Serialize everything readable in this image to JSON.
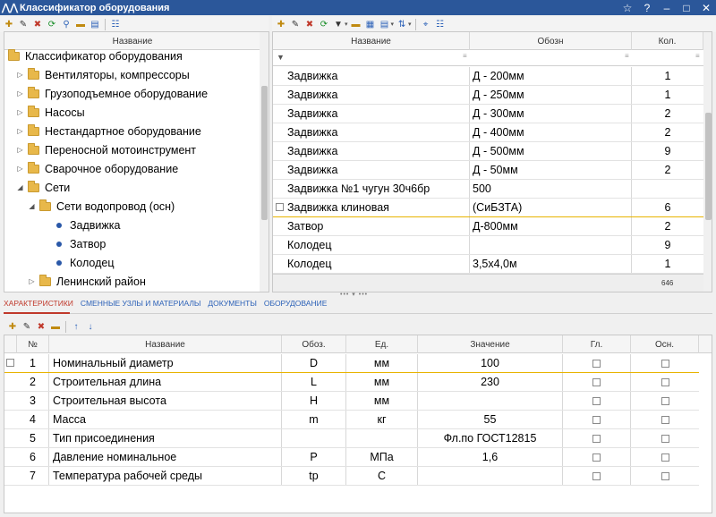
{
  "window": {
    "title": "Классификатор оборудования"
  },
  "tree": {
    "header": "Название",
    "items": [
      {
        "label": "Классификатор оборудования",
        "level": 0,
        "kind": "folder",
        "toggle": ""
      },
      {
        "label": "Вентиляторы, компрессоры",
        "level": 1,
        "kind": "folder",
        "toggle": "▷"
      },
      {
        "label": "Грузоподъемное оборудование",
        "level": 1,
        "kind": "folder",
        "toggle": "▷"
      },
      {
        "label": "Насосы",
        "level": 1,
        "kind": "folder",
        "toggle": "▷"
      },
      {
        "label": "Нестандартное оборудование",
        "level": 1,
        "kind": "folder",
        "toggle": "▷"
      },
      {
        "label": "Переносной мотоинструмент",
        "level": 1,
        "kind": "folder",
        "toggle": "▷"
      },
      {
        "label": "Сварочное оборудование",
        "level": 1,
        "kind": "folder",
        "toggle": "▷"
      },
      {
        "label": "Сети",
        "level": 1,
        "kind": "folder",
        "toggle": "◢"
      },
      {
        "label": "Сети водопровод (осн)",
        "level": 2,
        "kind": "folder",
        "toggle": "◢"
      },
      {
        "label": "Задвижка",
        "level": 3,
        "kind": "item",
        "toggle": ""
      },
      {
        "label": "Затвор",
        "level": 3,
        "kind": "item",
        "toggle": ""
      },
      {
        "label": "Колодец",
        "level": 3,
        "kind": "item",
        "toggle": ""
      },
      {
        "label": "Ленинский район",
        "level": 2,
        "kind": "folder",
        "toggle": "▷"
      }
    ]
  },
  "equipment_grid": {
    "columns": {
      "name": "Название",
      "code": "Обозн",
      "qty": "Кол."
    },
    "rows": [
      {
        "name": "Задвижка",
        "code": "Д - 200мм",
        "qty": "1"
      },
      {
        "name": "Задвижка",
        "code": "Д - 250мм",
        "qty": "1"
      },
      {
        "name": "Задвижка",
        "code": "Д - 300мм",
        "qty": "2"
      },
      {
        "name": "Задвижка",
        "code": "Д - 400мм",
        "qty": "2"
      },
      {
        "name": "Задвижка",
        "code": "Д - 500мм",
        "qty": "9"
      },
      {
        "name": "Задвижка",
        "code": "Д - 50мм",
        "qty": "2"
      },
      {
        "name": "Задвижка №1 чугун 30ч6бр",
        "code": "500",
        "qty": ""
      },
      {
        "name": "Задвижка клиновая",
        "code": "(СиБЗТА)",
        "qty": "6"
      },
      {
        "name": "Затвор",
        "code": "Д-800мм",
        "qty": "2"
      },
      {
        "name": "Колодец",
        "code": "",
        "qty": "9"
      },
      {
        "name": "Колодец",
        "code": "3,5х4,0м",
        "qty": "1"
      }
    ],
    "total": "646"
  },
  "tabs": [
    {
      "label": "ХАРАКТЕРИСТИКИ",
      "active": true
    },
    {
      "label": "СМЕННЫЕ УЗЛЫ И МАТЕРИАЛЫ",
      "active": false
    },
    {
      "label": "ДОКУМЕНТЫ",
      "active": false
    },
    {
      "label": "ОБОРУДОВАНИЕ",
      "active": false
    }
  ],
  "characteristics": {
    "columns": {
      "num": "№",
      "name": "Название",
      "sym": "Обоз.",
      "unit": "Ед.",
      "value": "Значение",
      "main": "Гл.",
      "base": "Осн."
    },
    "rows": [
      {
        "num": "1",
        "name": "Номинальный диаметр",
        "sym": "D",
        "unit": "мм",
        "value": "100"
      },
      {
        "num": "2",
        "name": "Строительная длина",
        "sym": "L",
        "unit": "мм",
        "value": "230"
      },
      {
        "num": "3",
        "name": "Строительная высота",
        "sym": "H",
        "unit": "мм",
        "value": ""
      },
      {
        "num": "4",
        "name": "Масса",
        "sym": "m",
        "unit": "кг",
        "value": "55"
      },
      {
        "num": "5",
        "name": "Тип присоединения",
        "sym": "",
        "unit": "",
        "value": "Фл.по ГОСТ12815"
      },
      {
        "num": "6",
        "name": "Давление номинальное",
        "sym": "P",
        "unit": "МПа",
        "value": "1,6"
      },
      {
        "num": "7",
        "name": "Температура рабочей среды",
        "sym": "tp",
        "unit": "С",
        "value": ""
      }
    ]
  },
  "colors": {
    "titlebar": "#2b579a",
    "accent_red": "#c0392b",
    "link_blue": "#2d62b8",
    "folder": "#e8b84a",
    "selection_line": "#e8b400"
  }
}
